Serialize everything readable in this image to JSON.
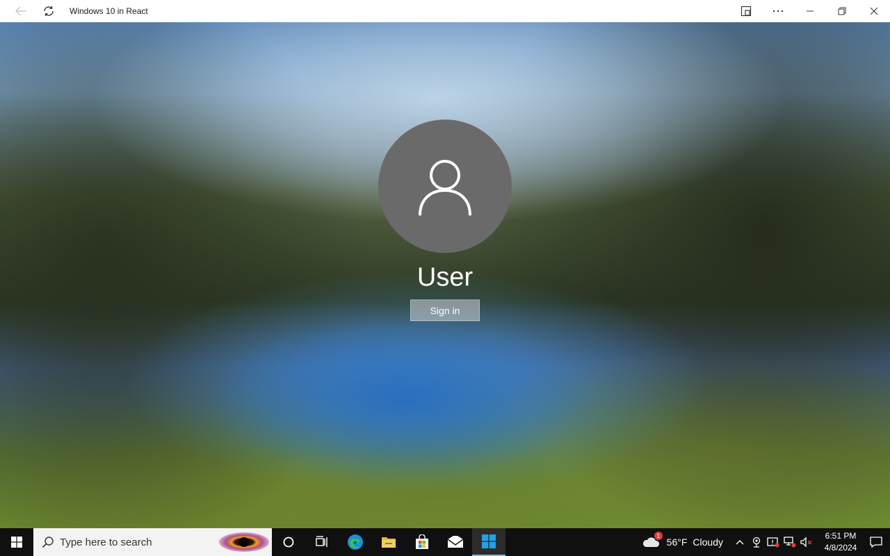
{
  "window": {
    "title": "Windows 10 in React",
    "icons": [
      "back-arrow-icon",
      "refresh-icon",
      "app-view-icon",
      "more-icon",
      "minimize-icon",
      "restore-icon",
      "close-icon"
    ]
  },
  "lockscreen": {
    "username": "User",
    "signin_label": "Sign in"
  },
  "taskbar": {
    "search_placeholder": "Type here to search",
    "apps": [
      "cortana-icon",
      "task-view-icon",
      "edge-icon",
      "file-explorer-icon",
      "store-icon",
      "mail-icon",
      "windows-app-icon"
    ],
    "weather": {
      "temperature": "56°F",
      "condition": "Cloudy",
      "badge": "1"
    },
    "clock": {
      "time": "6:51 PM",
      "date": "4/8/2024"
    }
  },
  "colors": {
    "accent": "#76b9ed",
    "taskbar": "#101010",
    "avatar": "#6a6a6a"
  }
}
